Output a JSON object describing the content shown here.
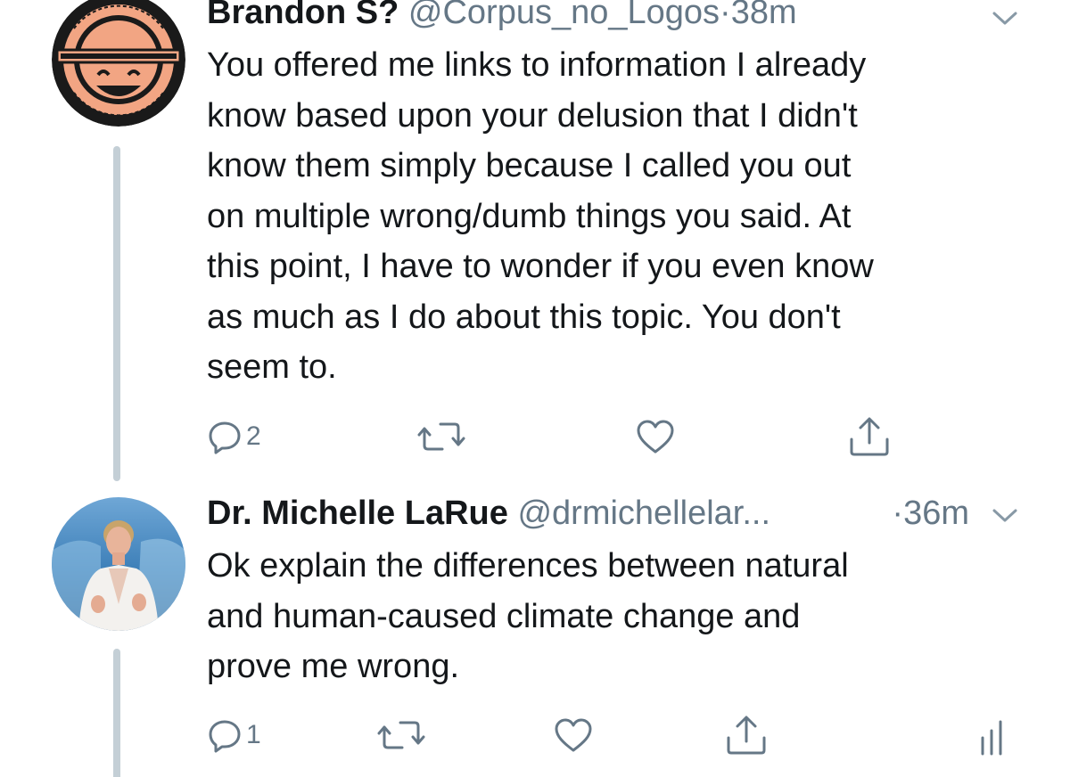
{
  "tweets": [
    {
      "display_name": "Brandon S?",
      "handle": "@Corpus_no_Logos",
      "dot": "·",
      "time": "38m",
      "avatar_icon": "laughing-man-logo",
      "avatar_logo_text": "I thought what I'd do was, I'd pretend I was one of those deaf-mutes",
      "lines": [
        "You offered me links to information I already",
        "know based upon your delusion that I didn't",
        "know them simply because I called you out",
        "on multiple wrong/dumb things you said.  At",
        "this point, I have to wonder if you even know",
        "as much as I do about this topic.  You don't",
        "seem to."
      ],
      "actions": {
        "reply_icon": "reply-icon",
        "reply_count": "2",
        "retweet_icon": "retweet-icon",
        "like_icon": "heart-icon",
        "share_icon": "share-icon"
      }
    },
    {
      "display_name": "Dr. Michelle LaRue",
      "handle": "@drmichellelar...",
      "dot": "·",
      "time": "36m",
      "avatar_icon": "speaker-photo",
      "lines": [
        "Ok explain the differences between natural",
        "and human-caused climate change and",
        "prove me wrong."
      ],
      "actions": {
        "reply_icon": "reply-icon",
        "reply_count": "1",
        "retweet_icon": "retweet-icon",
        "like_icon": "heart-icon",
        "share_icon": "share-icon",
        "analytics_icon": "analytics-icon"
      }
    }
  ],
  "colors": {
    "text": "#14171a",
    "secondary": "#657786",
    "thread_line": "#c4cfd6",
    "logo_orange": "#f2a583"
  }
}
